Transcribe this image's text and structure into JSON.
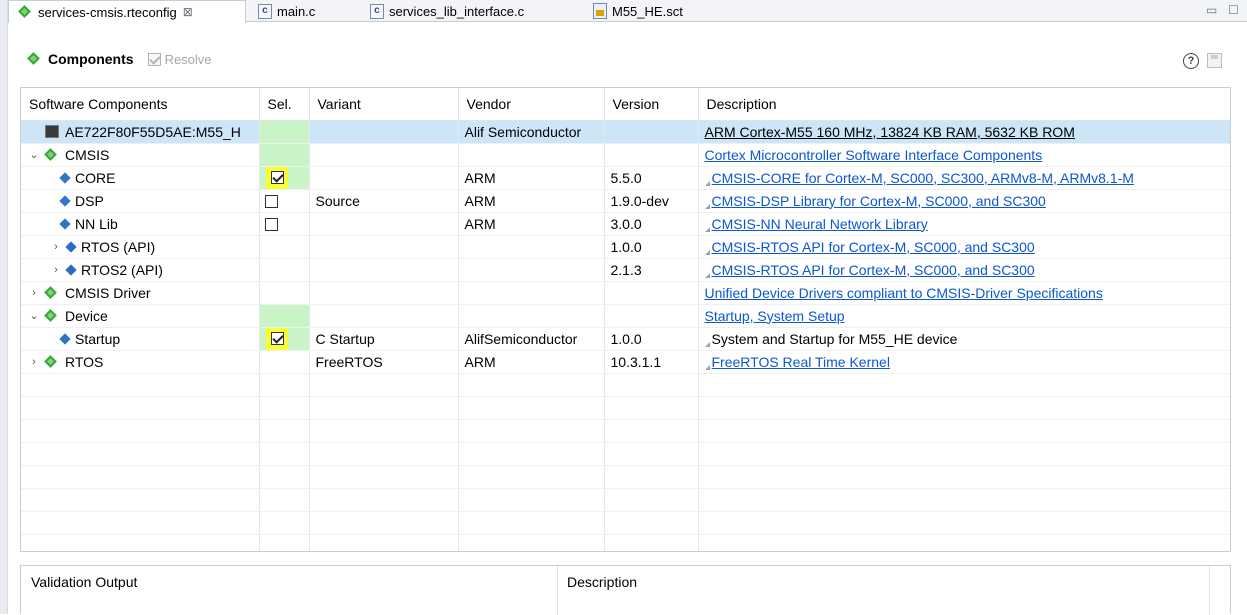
{
  "tabs": [
    {
      "label": "services-cmsis.rteconfig",
      "icon": "rte-gem-icon",
      "active": true,
      "close": "⊠"
    },
    {
      "label": "main.c",
      "icon": "c-file-icon"
    },
    {
      "label": "services_lib_interface.c",
      "icon": "c-file-icon"
    },
    {
      "label": "M55_HE.sct",
      "icon": "scatter-file-icon"
    }
  ],
  "toolbar": {
    "title": "Components",
    "resolve_label": "Resolve"
  },
  "table": {
    "headers": [
      "Software Components",
      "Sel.",
      "Variant",
      "Vendor",
      "Version",
      "Description"
    ],
    "rows": [
      {
        "name": "AE722F80F55D5AE:M55_H",
        "sel": "",
        "variant": "",
        "vendor": "Alif Semiconductor",
        "version": "",
        "description": "ARM Cortex-M55 160 MHz, 13824 KB RAM, 5632 KB ROM"
      },
      {
        "name": "CMSIS",
        "sel": "",
        "variant": "",
        "vendor": "",
        "version": "",
        "description": "Cortex Microcontroller Software Interface Components"
      },
      {
        "name": "CORE",
        "sel": "checked",
        "variant": "",
        "vendor": "ARM",
        "version": "5.5.0",
        "description": "CMSIS-CORE for Cortex-M, SC000, SC300, ARMv8-M, ARMv8.1-M"
      },
      {
        "name": "DSP",
        "sel": "unchecked",
        "variant": "Source",
        "vendor": "ARM",
        "version": "1.9.0-dev",
        "description": "CMSIS-DSP Library for Cortex-M, SC000, and SC300"
      },
      {
        "name": "NN Lib",
        "sel": "unchecked",
        "variant": "",
        "vendor": "ARM",
        "version": "3.0.0",
        "description": "CMSIS-NN Neural Network Library"
      },
      {
        "name": "RTOS (API)",
        "sel": "",
        "variant": "",
        "vendor": "",
        "version": "1.0.0",
        "description": "CMSIS-RTOS API for Cortex-M, SC000, and SC300"
      },
      {
        "name": "RTOS2 (API)",
        "sel": "",
        "variant": "",
        "vendor": "",
        "version": "2.1.3",
        "description": "CMSIS-RTOS API for Cortex-M, SC000, and SC300"
      },
      {
        "name": "CMSIS Driver",
        "sel": "",
        "variant": "",
        "vendor": "",
        "version": "",
        "description": "Unified Device Drivers compliant to CMSIS-Driver Specifications"
      },
      {
        "name": "Device",
        "sel": "",
        "variant": "",
        "vendor": "",
        "version": "",
        "description": "Startup, System Setup"
      },
      {
        "name": "Startup",
        "sel": "checked",
        "variant": "C Startup",
        "vendor": "AlifSemiconductor",
        "version": "1.0.0",
        "description": "System and Startup for M55_HE device"
      },
      {
        "name": "RTOS",
        "sel": "",
        "variant": "FreeRTOS",
        "vendor": "ARM",
        "version": "10.3.1.1",
        "description": "FreeRTOS Real Time Kernel"
      }
    ]
  },
  "bottom_panel": {
    "col1": "Validation Output",
    "col2": "Description"
  },
  "colors": {
    "selected_row": "#cde6f7",
    "sel_green": "#c8f4c8",
    "sel_yellow": "#f7ff35",
    "link": "#0b57d0"
  }
}
